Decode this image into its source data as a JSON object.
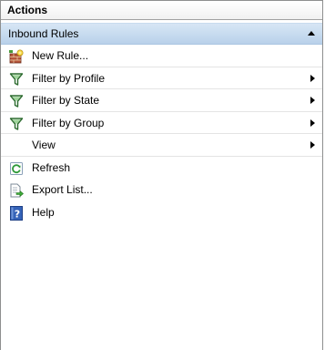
{
  "panel": {
    "title": "Actions"
  },
  "section": {
    "title": "Inbound Rules"
  },
  "actions": [
    {
      "label": "New Rule...",
      "icon": "new-rule-icon",
      "submenu": false
    },
    {
      "label": "Filter by Profile",
      "icon": "filter-icon",
      "submenu": true
    },
    {
      "label": "Filter by State",
      "icon": "filter-icon",
      "submenu": true
    },
    {
      "label": "Filter by Group",
      "icon": "filter-icon",
      "submenu": true
    },
    {
      "label": "View",
      "icon": "",
      "submenu": true
    },
    {
      "label": "Refresh",
      "icon": "refresh-icon",
      "submenu": false
    },
    {
      "label": "Export List...",
      "icon": "export-list-icon",
      "submenu": false
    },
    {
      "label": "Help",
      "icon": "help-icon",
      "submenu": false
    }
  ],
  "colors": {
    "section_header_top": "#d7e6f5",
    "section_header_bottom": "#b9d1ea",
    "panel_border": "#8e8f8f"
  }
}
